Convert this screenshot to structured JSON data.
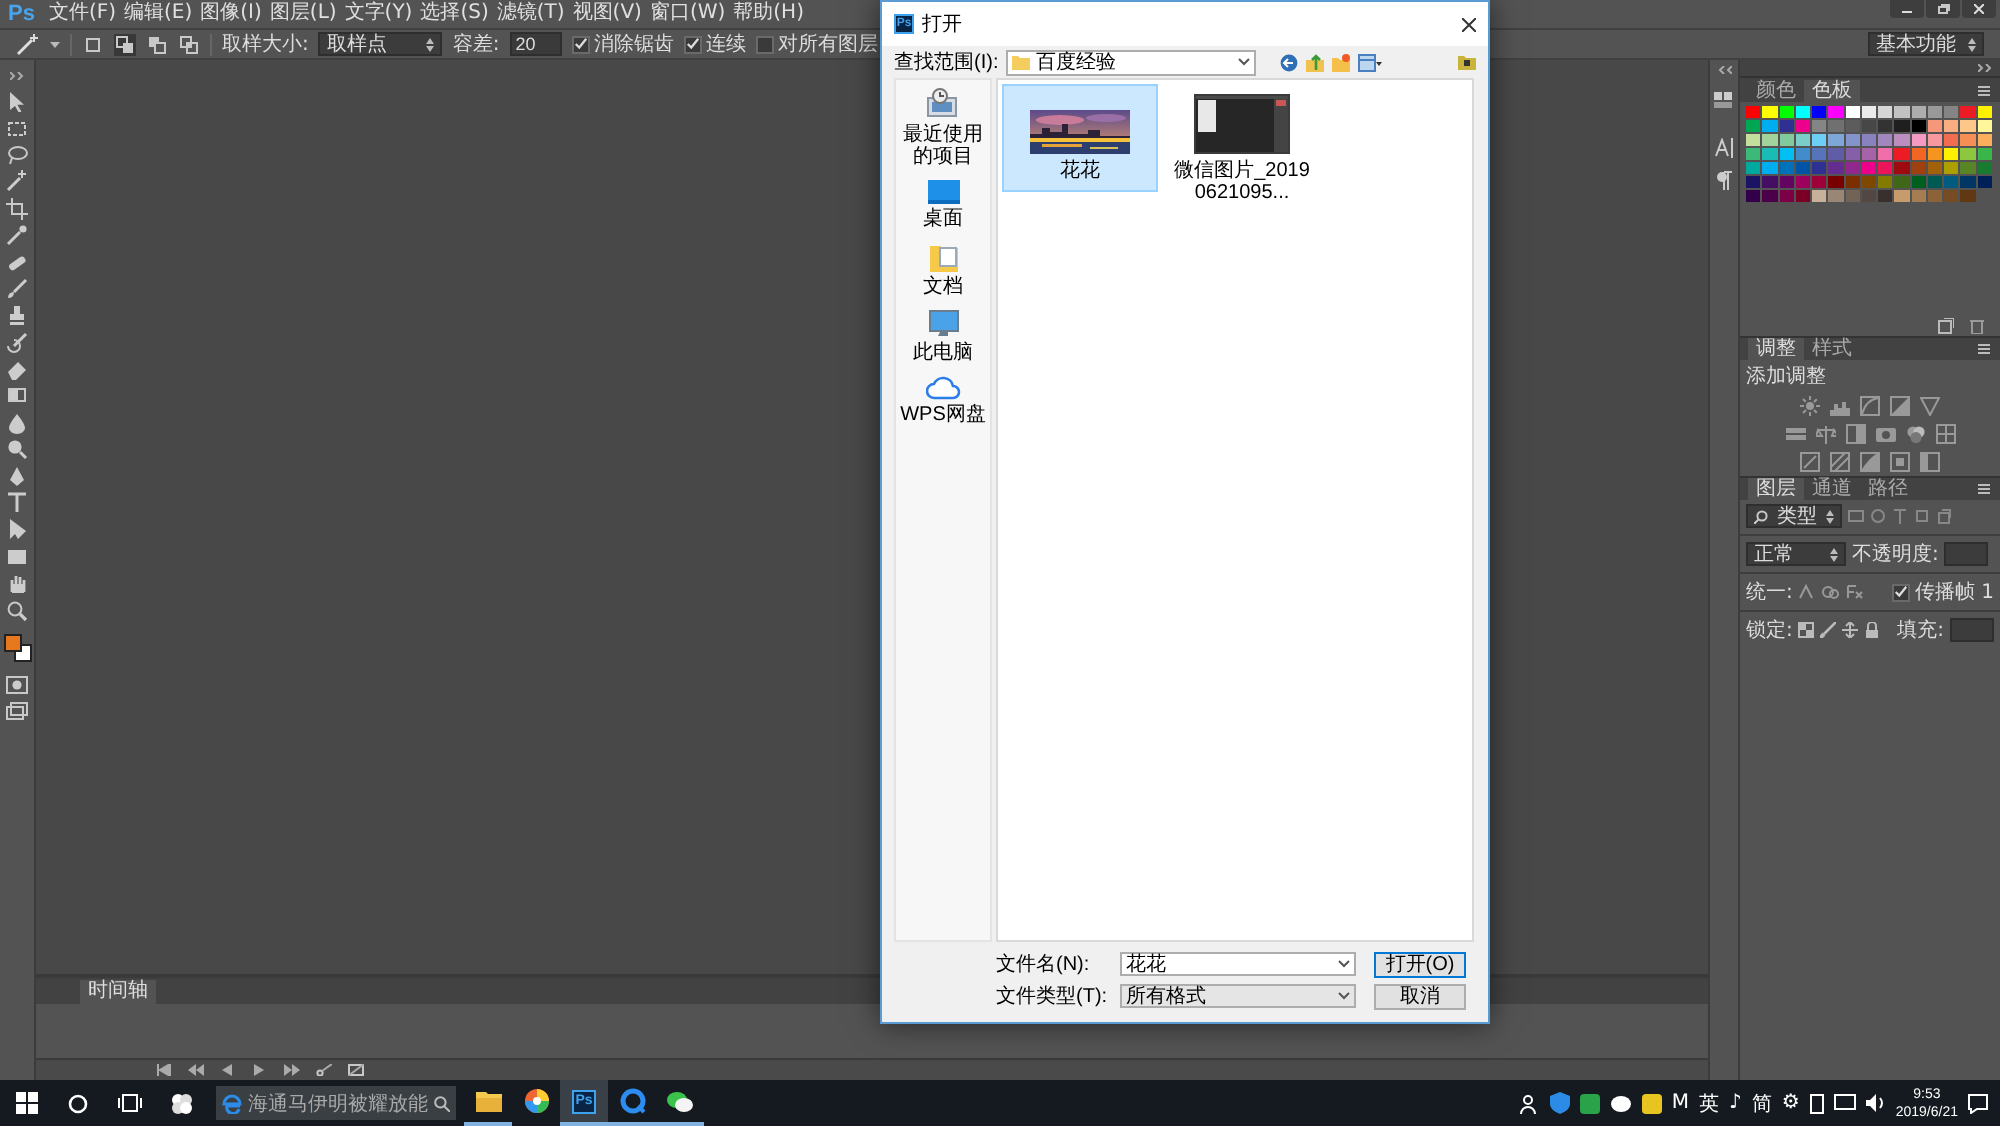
{
  "menubar": {
    "logo": "Ps",
    "items": [
      "文件(F)",
      "编辑(E)",
      "图像(I)",
      "图层(L)",
      "文字(Y)",
      "选择(S)",
      "滤镜(T)",
      "视图(V)",
      "窗口(W)",
      "帮助(H)"
    ]
  },
  "options": {
    "selection_modes": [
      {
        "selected": false
      },
      {
        "selected": true
      },
      {
        "selected": false
      },
      {
        "selected": false
      }
    ],
    "sample_size_label": "取样大小:",
    "sample_size": "取样点",
    "tolerance_label": "容差:",
    "tolerance": "20",
    "checks": [
      {
        "label": "消除锯齿",
        "checked": true
      },
      {
        "label": "连续",
        "checked": true
      },
      {
        "label": "对所有图层",
        "checked": false
      }
    ],
    "workspace": "基本功能"
  },
  "color_swatches": [
    {
      "kind": "background",
      "color": "#ffffff"
    },
    {
      "kind": "foreground",
      "color": "#e8781e"
    }
  ],
  "panels": {
    "swatches": {
      "tabs": [
        {
          "label": "颜色",
          "selected": false
        },
        {
          "label": "色板",
          "selected": true
        }
      ],
      "items": [
        {
          "color": "#ff0000"
        },
        {
          "color": "#ffff00"
        },
        {
          "color": "#00ff00"
        },
        {
          "color": "#00ffff"
        },
        {
          "color": "#0000ff"
        },
        {
          "color": "#ff00ff"
        },
        {
          "color": "#ffffff"
        },
        {
          "color": "#ebebeb"
        },
        {
          "color": "#d6d6d6"
        },
        {
          "color": "#c2c2c2"
        },
        {
          "color": "#adadad"
        },
        {
          "color": "#999999"
        },
        {
          "color": "#858585"
        },
        {
          "color": "#ed1c24"
        },
        {
          "color": "#fff200"
        },
        {
          "color": "#00a651"
        },
        {
          "color": "#00aeef"
        },
        {
          "color": "#2e3192"
        },
        {
          "color": "#ec008c"
        },
        {
          "color": "#858585"
        },
        {
          "color": "#707070"
        },
        {
          "color": "#5c5c5c"
        },
        {
          "color": "#474747"
        },
        {
          "color": "#333333"
        },
        {
          "color": "#1f1f1f"
        },
        {
          "color": "#000000"
        },
        {
          "color": "#f7977a"
        },
        {
          "color": "#f9ad81"
        },
        {
          "color": "#fdc68a"
        },
        {
          "color": "#fff79a"
        },
        {
          "color": "#c4df9b"
        },
        {
          "color": "#a3d39c"
        },
        {
          "color": "#82ca9d"
        },
        {
          "color": "#7bcdc8"
        },
        {
          "color": "#6ecff6"
        },
        {
          "color": "#7ea7d8"
        },
        {
          "color": "#8493ca"
        },
        {
          "color": "#8882be"
        },
        {
          "color": "#a187be"
        },
        {
          "color": "#bc8dbf"
        },
        {
          "color": "#f49ac2"
        },
        {
          "color": "#f6989d"
        },
        {
          "color": "#f26c4f"
        },
        {
          "color": "#f68e56"
        },
        {
          "color": "#fbaf5d"
        },
        {
          "color": "#3cb878"
        },
        {
          "color": "#1abbb4"
        },
        {
          "color": "#00bff3"
        },
        {
          "color": "#438ccb"
        },
        {
          "color": "#5574b9"
        },
        {
          "color": "#605ca8"
        },
        {
          "color": "#855fa8"
        },
        {
          "color": "#a763a8"
        },
        {
          "color": "#f06ea9"
        },
        {
          "color": "#ed1c24"
        },
        {
          "color": "#f26522"
        },
        {
          "color": "#f7941d"
        },
        {
          "color": "#fff200"
        },
        {
          "color": "#8dc73f"
        },
        {
          "color": "#39b54a"
        },
        {
          "color": "#00a99d"
        },
        {
          "color": "#00aeef"
        },
        {
          "color": "#0072bc"
        },
        {
          "color": "#0054a6"
        },
        {
          "color": "#2e3192"
        },
        {
          "color": "#662d91"
        },
        {
          "color": "#92278f"
        },
        {
          "color": "#ec008c"
        },
        {
          "color": "#ed145b"
        },
        {
          "color": "#9e0b0f"
        },
        {
          "color": "#a0410d"
        },
        {
          "color": "#a36209"
        },
        {
          "color": "#aba000"
        },
        {
          "color": "#598527"
        },
        {
          "color": "#197b30"
        },
        {
          "color": "#1b1464"
        },
        {
          "color": "#440e62"
        },
        {
          "color": "#630460"
        },
        {
          "color": "#9e005d"
        },
        {
          "color": "#9e0039"
        },
        {
          "color": "#790000"
        },
        {
          "color": "#7b2e00"
        },
        {
          "color": "#7d4900"
        },
        {
          "color": "#827b00"
        },
        {
          "color": "#406618"
        },
        {
          "color": "#005e20"
        },
        {
          "color": "#005952"
        },
        {
          "color": "#005b7f"
        },
        {
          "color": "#003663"
        },
        {
          "color": "#002157"
        },
        {
          "color": "#32004b"
        },
        {
          "color": "#4b0049"
        },
        {
          "color": "#7b0046"
        },
        {
          "color": "#7a0026"
        },
        {
          "color": "#c7b299"
        },
        {
          "color": "#998675"
        },
        {
          "color": "#736357"
        },
        {
          "color": "#534741"
        },
        {
          "color": "#37302d"
        },
        {
          "color": "#c69c6d"
        },
        {
          "color": "#a67c52"
        },
        {
          "color": "#8c6239"
        },
        {
          "color": "#754c24"
        },
        {
          "color": "#603913"
        }
      ]
    },
    "adjustments": {
      "tabs": [
        {
          "label": "调整",
          "selected": true
        },
        {
          "label": "样式",
          "selected": false
        }
      ],
      "heading": "添加调整"
    },
    "layers": {
      "tabs": [
        {
          "label": "图层",
          "selected": true
        },
        {
          "label": "通道",
          "selected": false
        },
        {
          "label": "路径",
          "selected": false
        }
      ],
      "filter": "类型",
      "blend_mode": "正常",
      "opacity_label": "不透明度:",
      "unify_label": "统一:",
      "propagate": {
        "label": "传播帧",
        "checked": true
      },
      "frame": "1",
      "lock_label": "锁定:",
      "fill_label": "填充:"
    }
  },
  "timeline": {
    "tab": "时间轴"
  },
  "dialog": {
    "app_icon": "Ps",
    "title": "打开",
    "look_in_label": "查找范围(I):",
    "look_in": "百度经验",
    "places": [
      {
        "kind": "recent",
        "label": "最近使用的项目"
      },
      {
        "kind": "desktop",
        "label": "桌面"
      },
      {
        "kind": "documents",
        "label": "文档"
      },
      {
        "kind": "computer",
        "label": "此电脑"
      },
      {
        "kind": "cloud",
        "label": "WPS网盘"
      }
    ],
    "files": [
      {
        "kind": "picture",
        "name": "花花",
        "selected": true
      },
      {
        "kind": "screenshot",
        "name": "微信图片_20190621095...",
        "selected": false
      }
    ],
    "file_name_label": "文件名(N):",
    "file_name": "花花",
    "file_type_label": "文件类型(T):",
    "file_type": "所有格式",
    "buttons": [
      "打开(O)",
      "取消"
    ]
  },
  "taskbar": {
    "search_placeholder": "海通马伊明被耀放能",
    "apps": [
      {
        "kind": "folder",
        "running": true,
        "selected": false
      },
      {
        "kind": "color-wheel",
        "running": false,
        "selected": false
      },
      {
        "kind": "photoshop",
        "label": "Ps",
        "running": true,
        "selected": true
      },
      {
        "kind": "browser",
        "running": true,
        "selected": false
      },
      {
        "kind": "chat",
        "running": true,
        "selected": false
      }
    ],
    "ime": [
      "M",
      "英",
      "♪",
      "简",
      "⚙"
    ],
    "time": "9:53",
    "date": "2019/6/21"
  }
}
